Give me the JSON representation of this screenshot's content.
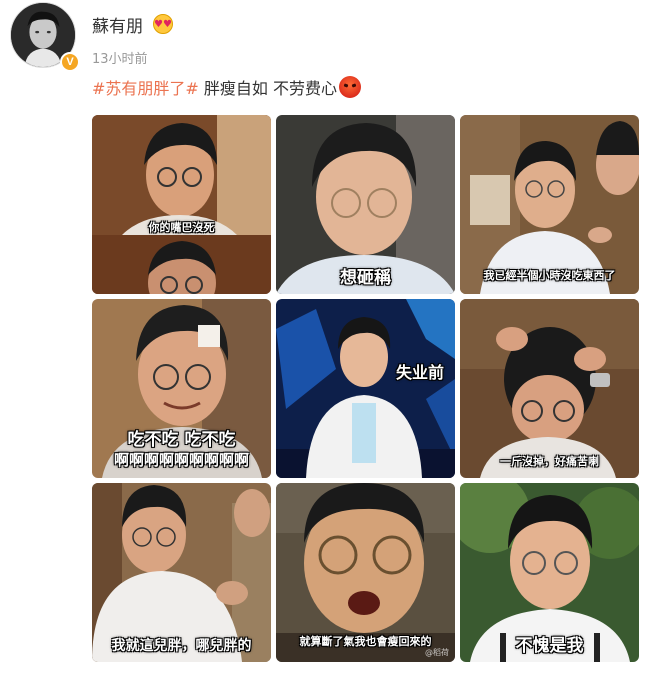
{
  "post": {
    "username": "蘇有朋",
    "timestamp": "13小时前",
    "verified_badge": "V",
    "content": {
      "hashtag": "#苏有朋胖了#",
      "text": " 胖瘦自如 不劳费心"
    }
  },
  "images": [
    {
      "caption": "你的嘴巴沒死",
      "caption_size": "small"
    },
    {
      "caption": "想砸稱",
      "caption_size": "large"
    },
    {
      "caption": "我已經半個小時沒吃東西了",
      "caption_size": "small"
    },
    {
      "caption": "吃不吃 吃不吃",
      "caption2": "啊啊啊啊啊啊啊啊啊",
      "caption_size": "large"
    },
    {
      "caption": "失业前",
      "caption_size": "large"
    },
    {
      "caption": "一斤沒掉，好痛苦喇",
      "caption_size": "small"
    },
    {
      "caption": "我就這兒胖，哪兒胖的",
      "caption_size": "medium"
    },
    {
      "caption": "就算斷了氣我也會瘦回來的",
      "caption_size": "small",
      "watermark": "@稻荷"
    },
    {
      "caption": "不愧是我",
      "caption_size": "large"
    }
  ],
  "colors": {
    "hashtag": "#eb7350",
    "badge": "#f5a623",
    "timestamp": "#999999"
  }
}
